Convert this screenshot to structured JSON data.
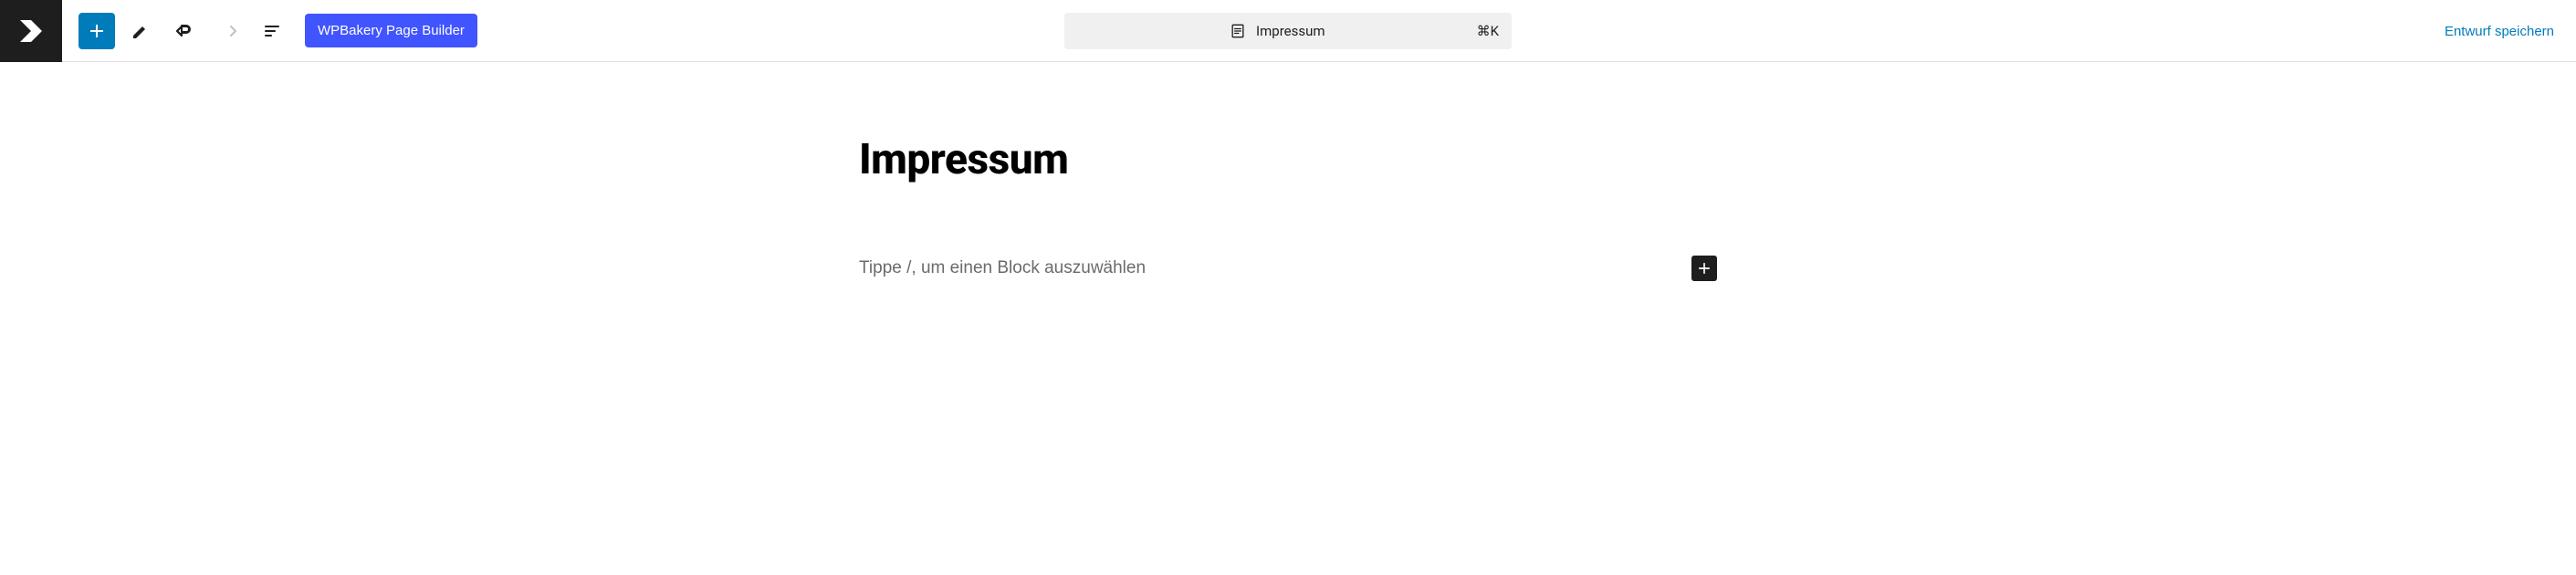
{
  "toolbar": {
    "wpbakery_label": "WPBakery Page Builder"
  },
  "doc_bar": {
    "title": "Impressum",
    "shortcut": "⌘K"
  },
  "actions": {
    "save_draft": "Entwurf speichern"
  },
  "editor": {
    "page_title": "Impressum",
    "block_placeholder": "Tippe /, um einen Block auszuwählen"
  }
}
